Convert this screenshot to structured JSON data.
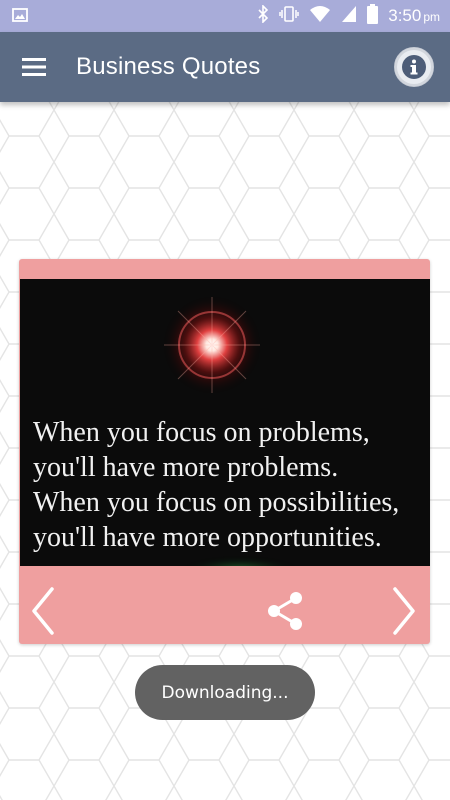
{
  "status_bar": {
    "time": "3:50",
    "ampm": "pm",
    "icons": [
      "image-icon",
      "bluetooth-icon",
      "vibrate-icon",
      "wifi-icon",
      "cell-signal-icon",
      "battery-icon"
    ]
  },
  "app_bar": {
    "title": "Business Quotes",
    "menu_icon": "hamburger-menu-icon",
    "info_icon": "info-icon"
  },
  "quote_card": {
    "text": "When you focus on problems,\nyou'll have more problems.\nWhen you focus on possibilities,\nyou'll have more opportunities.",
    "prev_icon": "chevron-left-icon",
    "share_icon": "share-icon",
    "next_icon": "chevron-right-icon"
  },
  "toast": {
    "message": "Downloading..."
  },
  "colors": {
    "status_bar": "#a8acd9",
    "app_bar": "#5b6b84",
    "card": "#ef9f9f",
    "toast": "#626262",
    "background_pattern": "#e6e6e6"
  }
}
